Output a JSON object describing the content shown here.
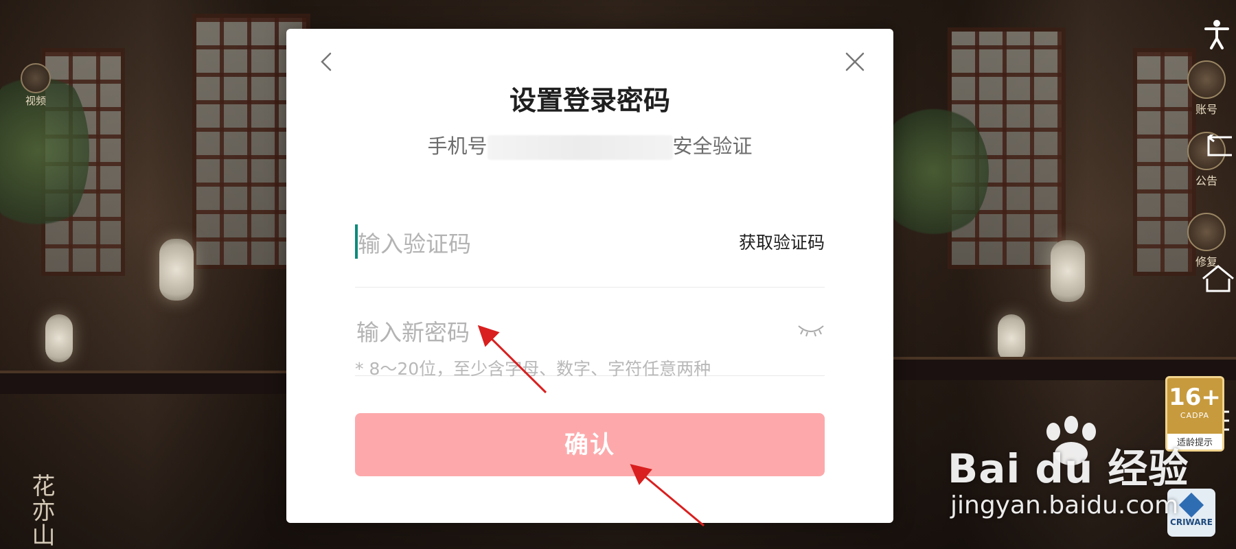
{
  "game": {
    "left_buttons": [
      {
        "label": "视频"
      }
    ],
    "right_buttons": [
      {
        "label": "账号"
      },
      {
        "label": "公告"
      },
      {
        "label": "修复"
      }
    ],
    "logo_text": "花亦山",
    "age_badge": {
      "age": "16+",
      "code": "CADPA",
      "caption": "适龄提示"
    },
    "criware_label": "CRIWARE"
  },
  "dialog": {
    "title": "设置登录密码",
    "subtitle_prefix": "手机号",
    "subtitle_suffix": "安全验证",
    "code_field": {
      "placeholder": "输入验证码",
      "action_label": "获取验证码"
    },
    "password_field": {
      "placeholder": "输入新密码"
    },
    "hint": "* 8～20位，至少含字母、数字、字符任意两种",
    "confirm_label": "确认"
  },
  "watermark": {
    "brand": "Bai du 经验",
    "url": "jingyan.baidu.com"
  },
  "colors": {
    "confirm_bg": "#fda9ab",
    "caret": "#0f8a7a",
    "badge": "#c79a3d"
  },
  "icons": {
    "back": "chevron-left-icon",
    "close": "close-icon",
    "eye": "eye-closed-icon"
  }
}
